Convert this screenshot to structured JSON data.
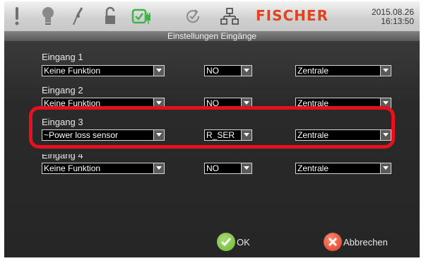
{
  "header": {
    "brand": "FISCHER",
    "date": "2015.08.26",
    "time": "16:13:50"
  },
  "page_title": "Einstellungen Eingänge",
  "inputs": [
    {
      "label": "Eingang 1",
      "function": "Keine Funktion",
      "mode": "NO",
      "target": "Zentrale"
    },
    {
      "label": "Eingang 2",
      "function": "Keine Funktion",
      "mode": "NO",
      "target": "Zentrale"
    },
    {
      "label": "Eingang 3",
      "function": "~Power loss sensor",
      "mode": "R_SER",
      "target": "Zentrale"
    },
    {
      "label": "Eingang 4",
      "function": "Keine Funktion",
      "mode": "NO",
      "target": "Zentrale"
    }
  ],
  "buttons": {
    "ok": "OK",
    "cancel": "Abbrechen"
  },
  "colors": {
    "brand": "#e2421e",
    "highlight": "#e8101e",
    "ok": "#7cc242",
    "cancel": "#e8402a"
  }
}
